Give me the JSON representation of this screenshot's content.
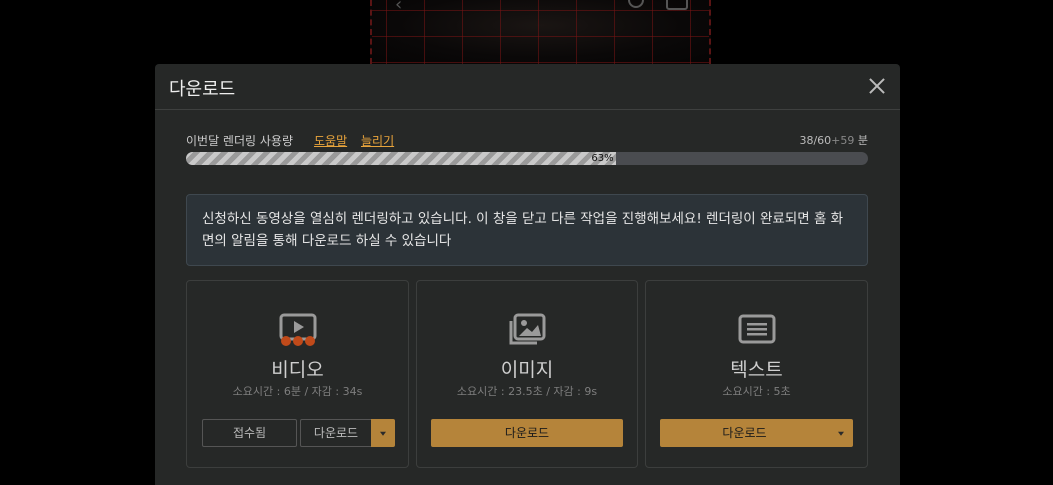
{
  "modal": {
    "title": "다운로드"
  },
  "usage": {
    "label": "이번달 렌더링 사용량",
    "help_link": "도움말",
    "increase_link": "늘리기",
    "used": "38/60",
    "extra": "+59",
    "unit": "분",
    "percent_text": "63%",
    "percent": 63
  },
  "notice": {
    "text": "신청하신 동영상을 열심히 렌더링하고 있습니다. 이 창을 닫고 다른 작업을 진행해보세요! 렌더링이 완료되면 홈 화면의 알림을 통해 다운로드 하실 수 있습니다"
  },
  "cards": {
    "video": {
      "icon": "video-play-icon",
      "title": "비디오",
      "time": "소요시간 : 6분 / 자감 : 34s",
      "received_label": "접수됨",
      "download_label": "다운로드"
    },
    "image": {
      "icon": "image-icon",
      "title": "이미지",
      "time": "소요시간 : 23.5초 / 자감 : 9s",
      "download_label": "다운로드"
    },
    "text": {
      "icon": "text-document-icon",
      "title": "텍스트",
      "time": "소요시간 : 5초",
      "download_label": "다운로드"
    }
  },
  "colors": {
    "accent": "#b5843a",
    "link": "#e8a43c",
    "modal_bg": "#262827"
  }
}
